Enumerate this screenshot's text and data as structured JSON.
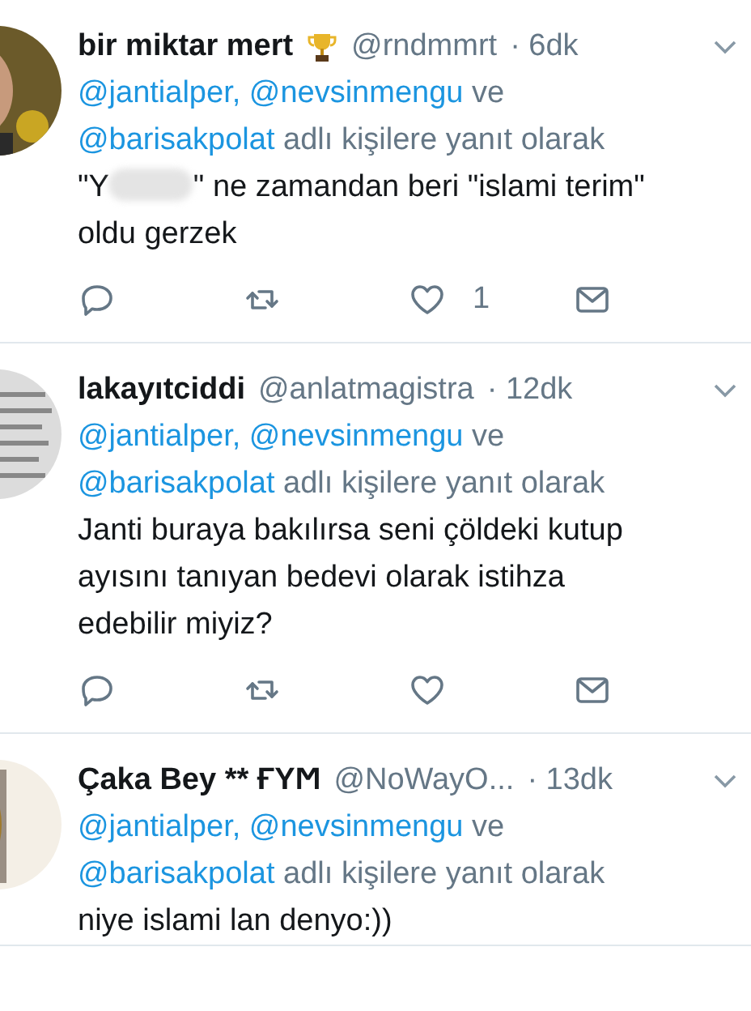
{
  "tweets": [
    {
      "name": "bir miktar mert",
      "trophy": true,
      "handle": "@rndmmrt",
      "time": "· 6dk",
      "reply_line": [
        {
          "kind": "mention",
          "text": "@jantialper,"
        },
        {
          "kind": "mention",
          "text": "@nevsinmengu"
        },
        {
          "kind": "plain",
          "text": "ve"
        },
        {
          "kind": "mention",
          "text": "@barisakpolat"
        },
        {
          "kind": "plain",
          "text": "adlı kişilere yanıt olarak"
        }
      ],
      "text_before_blur": "\"Y",
      "text_after_blur": "\" ne zamandan beri \"islami terim\" oldu gerzek",
      "like_count": "1"
    },
    {
      "name": "lakayıtciddi",
      "handle": "@anlatmagistra",
      "time": "· 12dk",
      "reply_line": [
        {
          "kind": "mention",
          "text": "@jantialper,"
        },
        {
          "kind": "mention",
          "text": "@nevsinmengu"
        },
        {
          "kind": "plain",
          "text": "ve"
        },
        {
          "kind": "mention",
          "text": "@barisakpolat"
        },
        {
          "kind": "plain",
          "text": "adlı kişilere yanıt olarak"
        }
      ],
      "text": "Janti buraya bakılırsa seni çöldeki kutup ayısını tanıyan bedevi olarak istihza edebilir miyiz?"
    },
    {
      "name": "Çaka Bey ** ҒΥϺ",
      "handle": "@NoWayO...",
      "time": "· 13dk",
      "reply_line": [
        {
          "kind": "mention",
          "text": "@jantialper,"
        },
        {
          "kind": "mention",
          "text": "@nevsinmengu"
        },
        {
          "kind": "plain",
          "text": "ve"
        },
        {
          "kind": "mention",
          "text": "@barisakpolat"
        },
        {
          "kind": "plain",
          "text": "adlı kişilere yanıt olarak"
        }
      ],
      "text": "niye islami lan denyo:))"
    }
  ]
}
